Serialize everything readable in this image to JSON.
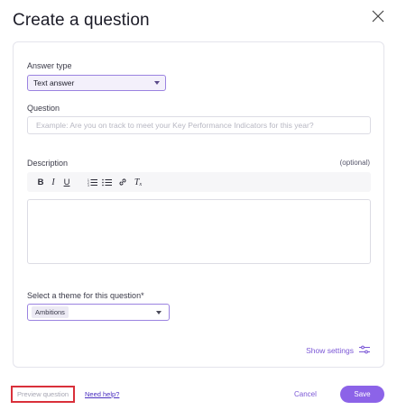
{
  "dialog": {
    "title": "Create a question"
  },
  "form": {
    "answer_type": {
      "label": "Answer type",
      "selected": "Text answer"
    },
    "question": {
      "label": "Question",
      "placeholder": "Example: Are you on track to meet your Key Performance Indicators for this year?",
      "value": ""
    },
    "description": {
      "label": "Description",
      "optional": "(optional)",
      "toolbar": {
        "bold": "B",
        "italic": "I",
        "underline": "U",
        "clear_format": "T"
      }
    },
    "theme": {
      "label": "Select a theme for this question*",
      "selected_chip": "Ambitions"
    },
    "show_settings": "Show settings"
  },
  "footer": {
    "preview": "Preview question",
    "help": "Need help?",
    "cancel": "Cancel",
    "save": "Save"
  },
  "colors": {
    "accent": "#8c63e8",
    "link": "#7b57d6",
    "highlight_border": "#d9303a"
  }
}
